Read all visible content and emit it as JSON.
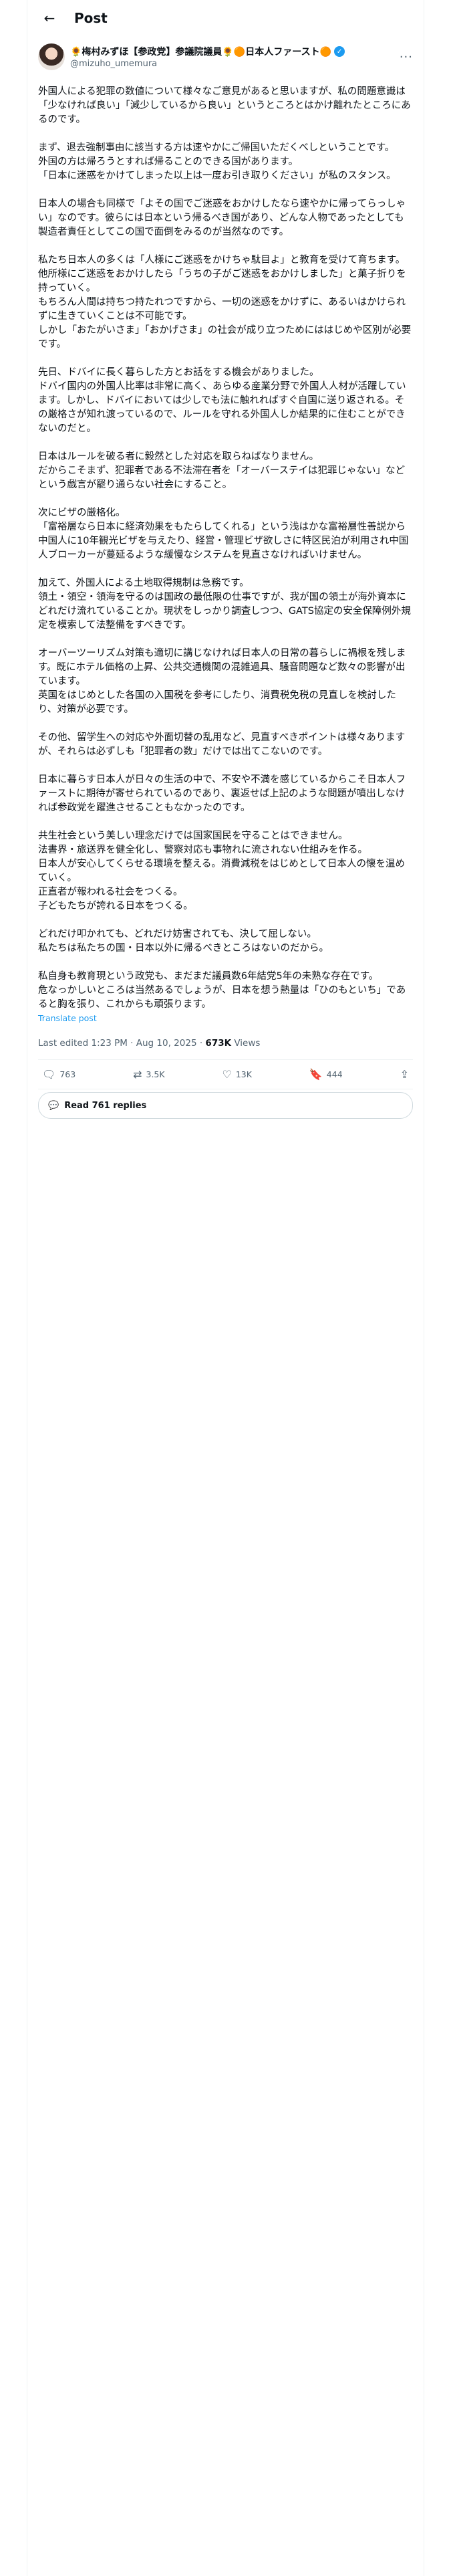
{
  "header": {
    "title": "Post",
    "back_icon": "arrow-left-icon"
  },
  "author": {
    "display_name": "🌻梅村みずほ【参政党】参議院議員🌻🟠日本人ファースト🟠",
    "handle": "@mizuho_umemura",
    "verified_mark": "✓"
  },
  "post": {
    "text": "外国人による犯罪の数値について様々なご意見があると思いますが、私の問題意識は「少なければ良い」「減少しているから良い」というところとはかけ離れたところにあるのです。\n\nまず、退去強制事由に該当する方は速やかにご帰国いただくべしということです。\n外国の方は帰ろうとすれば帰ることのできる国があります。\n「日本に迷惑をかけてしまった以上は一度お引き取りください」が私のスタンス。\n\n日本人の場合も同様で「よその国でご迷惑をおかけしたなら速やかに帰ってらっしゃい」なのです。彼らには日本という帰るべき国があり、どんな人物であったとしても製造者責任としてこの国で面倒をみるのが当然なのです。\n\n私たち日本人の多くは「人様にご迷惑をかけちゃ駄目よ」と教育を受けて育ちます。\n他所様にご迷惑をおかけしたら「うちの子がご迷惑をおかけしました」と菓子折りを持っていく。\nもちろん人間は持ちつ持たれつですから、一切の迷惑をかけずに、あるいはかけられずに生きていくことは不可能です。\nしかし「おたがいさま」「おかげさま」の社会が成り立つためにははじめや区別が必要です。\n\n先日、ドバイに長く暮らした方とお話をする機会がありました。\nドバイ国内の外国人比率は非常に高く、あらゆる産業分野で外国人人材が活躍しています。しかし、ドバイにおいては少しでも法に触れればすぐ自国に送り返される。その厳格さが知れ渡っているので、ルールを守れる外国人しか結果的に住むことができないのだと。\n\n日本はルールを破る者に毅然とした対応を取らねばなりません。\nだからこそまず、犯罪者である不法滞在者を「オーバーステイは犯罪じゃない」などという戯言が罷り通らない社会にすること。\n\n次にビザの厳格化。\n「富裕層なら日本に経済効果をもたらしてくれる」という浅はかな富裕層性善説から中国人に10年観光ビザを与えたり、経営・管理ビザ欲しさに特区民泊が利用され中国人ブローカーが蔓延るような緩慢なシステムを見直さなければいけません。\n\n加えて、外国人による土地取得規制は急務です。\n領土・領空・領海を守るのは国政の最低限の仕事ですが、我が国の領土が海外資本にどれだけ流れていることか。現状をしっかり調査しつつ、GATS協定の安全保障例外規定を模索して法整備をすべきです。\n\nオーバーツーリズム対策も適切に講じなければ日本人の日常の暮らしに禍根を残します。既にホテル価格の上昇、公共交通機関の混雑過具、騒音問題など数々の影響が出ています。\n英国をはじめとした各国の入国税を参考にしたり、消費税免税の見直しを検討したり、対策が必要です。\n\nその他、留学生への対応や外面切替の乱用など、見直すべきポイントは様々ありますが、それらは必ずしも「犯罪者の数」だけでは出てこないのです。\n\n日本に暮らす日本人が日々の生活の中で、不安や不満を感じているからこそ日本人ファーストに期待が寄せられているのであり、裏返せば上記のような問題が噴出しなければ参政党を躍進させることもなかったのです。\n\n共生社会という美しい理念だけでは国家国民を守ることはできません。\n法書界・旅送界を健全化し、警察対応も事物れに流されない仕組みを作る。\n日本人が安心してくらせる環境を整える。消費減税をはじめとして日本人の懐を温めていく。\n正直者が報われる社会をつくる。\n子どもたちが誇れる日本をつくる。\n\nどれだけ叩かれても、どれだけ妨害されても、決して屈しない。\n私たちは私たちの国・日本以外に帰るべきところはないのだから。\n\n私自身も教育現という政党も、まだまだ議員数6年結党5年の未熟な存在です。\n危なっかしいところは当然あるでしょうが、日本を想う熱量は「ひのもといち」であると胸を張り、これからも頑張ります。",
    "translate_label": "Translate post",
    "timestamp": "Last edited 1:23 PM · Aug 10, 2025 · ",
    "views_count": "673K",
    "views_label": " Views"
  },
  "actions": {
    "replies": "763",
    "reposts": "3.5K",
    "likes": "13K",
    "bookmarks": "444"
  },
  "read_replies_label": "Read 761 replies"
}
